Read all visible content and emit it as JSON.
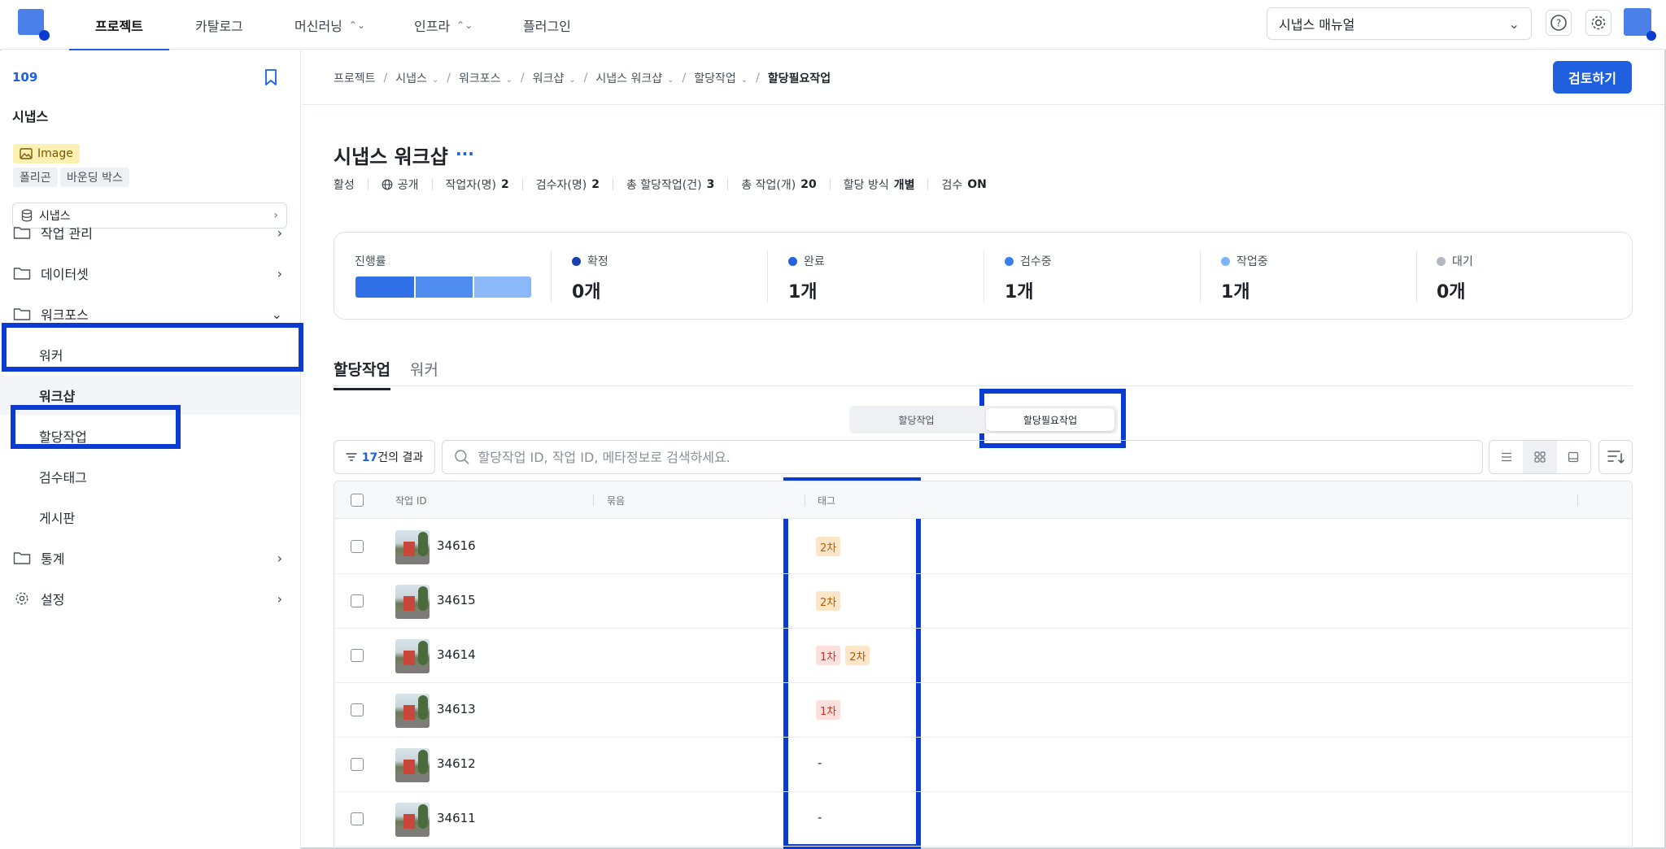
{
  "nav": {
    "tabs": [
      {
        "label": "프로젝트",
        "active": true
      },
      {
        "label": "카탈로그"
      },
      {
        "label": "머신러닝",
        "dropdown": true
      },
      {
        "label": "인프라",
        "dropdown": true
      },
      {
        "label": "플러그인"
      }
    ],
    "manual_select": "시냅스 매뉴얼",
    "help_icon": "help-icon",
    "settings_icon": "gear-icon"
  },
  "sidebar": {
    "project_id": "109",
    "project_name": "시냅스",
    "image_badge": "Image",
    "chips": [
      "폴리곤",
      "바운딩 박스"
    ],
    "dataset": "시냅스",
    "items": [
      {
        "label": "작업 관리",
        "icon": "folder-icon"
      },
      {
        "label": "데이터셋",
        "icon": "folder-icon"
      },
      {
        "label": "워크포스",
        "icon": "folder-icon",
        "expanded": true
      },
      {
        "label": "통계",
        "icon": "folder-icon"
      },
      {
        "label": "설정",
        "icon": "gear-icon"
      }
    ],
    "subitems": [
      {
        "label": "워커"
      },
      {
        "label": "워크샵",
        "selected": true
      },
      {
        "label": "할당작업"
      },
      {
        "label": "검수태그"
      },
      {
        "label": "게시판"
      }
    ]
  },
  "breadcrumb": [
    {
      "label": "프로젝트"
    },
    {
      "label": "시냅스",
      "dropdown": true
    },
    {
      "label": "워크포스",
      "dropdown": true
    },
    {
      "label": "워크샵",
      "dropdown": true
    },
    {
      "label": "시냅스 워크샵",
      "dropdown": true
    },
    {
      "label": "할당작업",
      "dropdown": true
    },
    {
      "label": "할당필요작업"
    }
  ],
  "review_button": "검토하기",
  "workshop": {
    "title": "시냅스 워크샵",
    "more": "···",
    "meta": {
      "status": "활성",
      "visibility": "공개",
      "workers_label": "작업자(명)",
      "workers": "2",
      "reviewers_label": "검수자(명)",
      "reviewers": "2",
      "total_assign_label": "총 할당작업(건)",
      "total_assign": "3",
      "total_tasks_label": "총 작업(개)",
      "total_tasks": "20",
      "assign_method_label": "할당 방식",
      "assign_method": "개별",
      "review_label": "검수",
      "review": "ON"
    }
  },
  "progress": {
    "label": "진행률",
    "segments": [
      {
        "fraction": 0.333,
        "color": "#2f6fe8"
      },
      {
        "fraction": 0.333,
        "color": "#4f8cf0"
      },
      {
        "fraction": 0.334,
        "color": "#8ab8f8"
      }
    ],
    "stats": [
      {
        "label": "확정",
        "value": "0개",
        "color": "#1c3fb0"
      },
      {
        "label": "완료",
        "value": "1개",
        "color": "#2462e0"
      },
      {
        "label": "검수중",
        "value": "1개",
        "color": "#3a7ff0"
      },
      {
        "label": "작업중",
        "value": "1개",
        "color": "#7db3f7"
      },
      {
        "label": "대기",
        "value": "0개",
        "color": "#b3b8c0"
      }
    ]
  },
  "tabs": [
    {
      "label": "할당작업",
      "active": true
    },
    {
      "label": "워커"
    }
  ],
  "segment": [
    {
      "label": "할당작업"
    },
    {
      "label": "할당필요작업",
      "active": true
    }
  ],
  "filter": {
    "count": "17",
    "suffix": "건의 결과"
  },
  "search": {
    "placeholder": "할당작업 ID, 작업 ID, 메타정보로 검색하세요.",
    "value": ""
  },
  "table": {
    "headers": {
      "task_id": "작업 ID",
      "bundle": "묶음",
      "tag": "태그"
    },
    "rows": [
      {
        "id": "34616",
        "tags": [
          "2차"
        ]
      },
      {
        "id": "34615",
        "tags": [
          "2차"
        ]
      },
      {
        "id": "34614",
        "tags": [
          "1차",
          "2차"
        ]
      },
      {
        "id": "34613",
        "tags": [
          "1차"
        ]
      },
      {
        "id": "34612",
        "tags": [],
        "empty": "-"
      },
      {
        "id": "34611",
        "tags": [],
        "empty": "-"
      }
    ]
  }
}
